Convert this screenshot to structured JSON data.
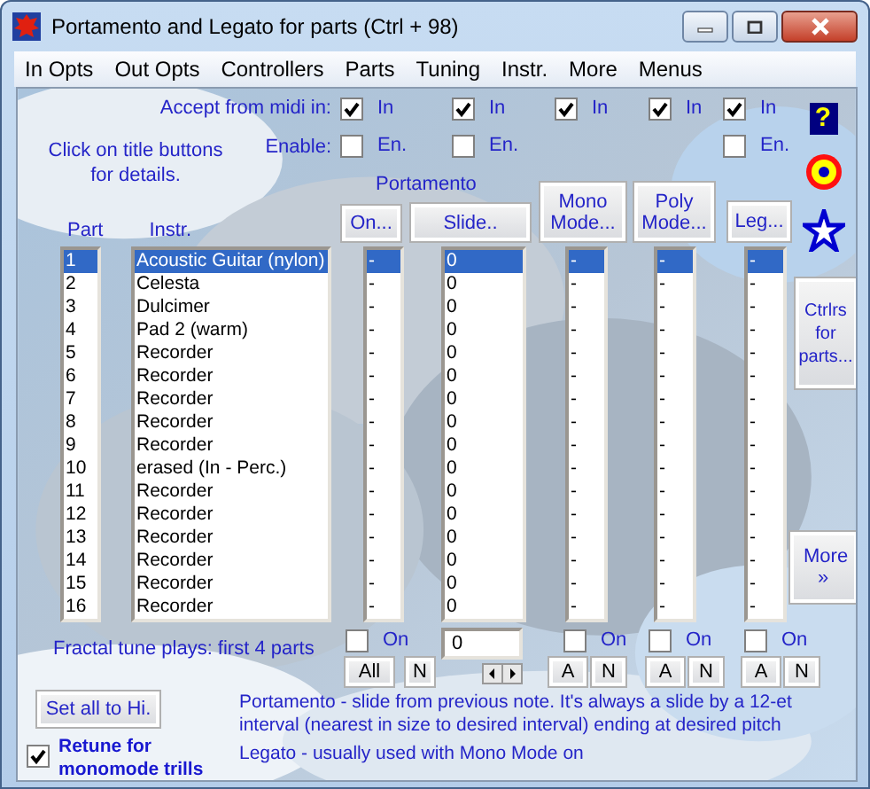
{
  "window": {
    "title": "Portamento and Legato for parts (Ctrl + 98)"
  },
  "menu": [
    "In Opts",
    "Out Opts",
    "Controllers",
    "Parts",
    "Tuning",
    "Instr.",
    "More",
    "Menus"
  ],
  "accept_label": "Accept from midi in:",
  "enable_label": "Enable:",
  "hint": "Click on title buttons for details.",
  "portamento_label": "Portamento",
  "midi_columns": [
    {
      "accept": {
        "label": "In",
        "checked": true
      },
      "enable": {
        "label": "En.",
        "checked": false
      }
    },
    {
      "accept": {
        "label": "In",
        "checked": true
      },
      "enable": {
        "label": "En.",
        "checked": false
      }
    },
    {
      "accept": {
        "label": "In",
        "checked": true
      }
    },
    {
      "accept": {
        "label": "In",
        "checked": true
      }
    },
    {
      "accept": {
        "label": "In",
        "checked": true
      },
      "enable": {
        "label": "En.",
        "checked": false
      }
    }
  ],
  "column_buttons": [
    "On...",
    "Slide..",
    "Mono Mode...",
    "Poly Mode...",
    "Leg..."
  ],
  "list_headers": [
    "Part",
    "Instr."
  ],
  "parts": [
    {
      "part": "1",
      "instrument": "Acoustic Guitar (nylon)",
      "on": "-",
      "slide": "0",
      "mono": "-",
      "poly": "-",
      "leg": "-",
      "selected": true
    },
    {
      "part": "2",
      "instrument": "Celesta",
      "on": "-",
      "slide": "0",
      "mono": "-",
      "poly": "-",
      "leg": "-",
      "selected": false
    },
    {
      "part": "3",
      "instrument": "Dulcimer",
      "on": "-",
      "slide": "0",
      "mono": "-",
      "poly": "-",
      "leg": "-",
      "selected": false
    },
    {
      "part": "4",
      "instrument": "Pad 2 (warm)",
      "on": "-",
      "slide": "0",
      "mono": "-",
      "poly": "-",
      "leg": "-",
      "selected": false
    },
    {
      "part": "5",
      "instrument": "Recorder",
      "on": "-",
      "slide": "0",
      "mono": "-",
      "poly": "-",
      "leg": "-",
      "selected": false
    },
    {
      "part": "6",
      "instrument": "Recorder",
      "on": "-",
      "slide": "0",
      "mono": "-",
      "poly": "-",
      "leg": "-",
      "selected": false
    },
    {
      "part": "7",
      "instrument": "Recorder",
      "on": "-",
      "slide": "0",
      "mono": "-",
      "poly": "-",
      "leg": "-",
      "selected": false
    },
    {
      "part": "8",
      "instrument": "Recorder",
      "on": "-",
      "slide": "0",
      "mono": "-",
      "poly": "-",
      "leg": "-",
      "selected": false
    },
    {
      "part": "9",
      "instrument": "Recorder",
      "on": "-",
      "slide": "0",
      "mono": "-",
      "poly": "-",
      "leg": "-",
      "selected": false
    },
    {
      "part": "10",
      "instrument": "erased  (In - Perc.)",
      "on": "-",
      "slide": "0",
      "mono": "-",
      "poly": "-",
      "leg": "-",
      "selected": false
    },
    {
      "part": "11",
      "instrument": "Recorder",
      "on": "-",
      "slide": "0",
      "mono": "-",
      "poly": "-",
      "leg": "-",
      "selected": false
    },
    {
      "part": "12",
      "instrument": "Recorder",
      "on": "-",
      "slide": "0",
      "mono": "-",
      "poly": "-",
      "leg": "-",
      "selected": false
    },
    {
      "part": "13",
      "instrument": "Recorder",
      "on": "-",
      "slide": "0",
      "mono": "-",
      "poly": "-",
      "leg": "-",
      "selected": false
    },
    {
      "part": "14",
      "instrument": "Recorder",
      "on": "-",
      "slide": "0",
      "mono": "-",
      "poly": "-",
      "leg": "-",
      "selected": false
    },
    {
      "part": "15",
      "instrument": "Recorder",
      "on": "-",
      "slide": "0",
      "mono": "-",
      "poly": "-",
      "leg": "-",
      "selected": false
    },
    {
      "part": "16",
      "instrument": "Recorder",
      "on": "-",
      "slide": "0",
      "mono": "-",
      "poly": "-",
      "leg": "-",
      "selected": false
    }
  ],
  "footers": [
    {
      "kind": "check",
      "label": "On",
      "checked": false,
      "buttons": [
        "All",
        "N"
      ]
    },
    {
      "kind": "field",
      "value": "0"
    },
    {
      "kind": "check",
      "label": "On",
      "checked": false,
      "buttons": [
        "A",
        "N"
      ]
    },
    {
      "kind": "check",
      "label": "On",
      "checked": false,
      "buttons": [
        "A",
        "N"
      ]
    },
    {
      "kind": "check",
      "label": "On",
      "checked": false,
      "buttons": [
        "A",
        "N"
      ]
    }
  ],
  "fractal_note": "Fractal tune plays: first 4 parts",
  "set_all_button": "Set all to Hi.",
  "retune": {
    "label": "Retune for monomode trills",
    "checked": true
  },
  "descriptions": [
    "Portamento - slide from previous note. It's always a slide by a 12-et interval (nearest in size to desired interval) ending at desired pitch",
    "Legato - usually used with Mono Mode on"
  ],
  "side": {
    "help": "?",
    "buttons": [
      "Ctrlrs for parts...",
      "More »"
    ]
  }
}
